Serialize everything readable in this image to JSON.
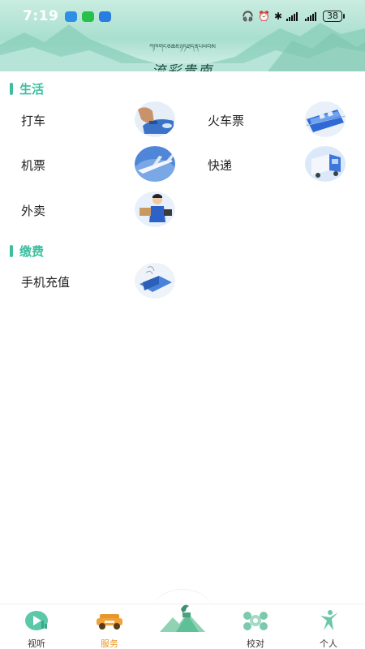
{
  "status_bar": {
    "time": "7:19",
    "battery": "38"
  },
  "brand": {
    "script_text": "ཀཁགངཅཆཇཉཏཐདནཔཕབམ",
    "title": "流彩贵南"
  },
  "sections": [
    {
      "title": "生活",
      "items": [
        {
          "label": "打车",
          "icon": "taxi-hand-icon"
        },
        {
          "label": "火车票",
          "icon": "train-icon"
        },
        {
          "label": "机票",
          "icon": "airplane-icon"
        },
        {
          "label": "快递",
          "icon": "delivery-truck-icon"
        },
        {
          "label": "外卖",
          "icon": "courier-icon"
        }
      ]
    },
    {
      "title": "缴费",
      "items": [
        {
          "label": "手机充值",
          "icon": "phone-recharge-icon"
        }
      ]
    }
  ],
  "tabbar": {
    "tabs": [
      {
        "label": "视听",
        "icon": "video-play-icon",
        "active": false
      },
      {
        "label": "服务",
        "icon": "car-icon",
        "active": true
      },
      {
        "label": "",
        "icon": "mountain-goat-icon",
        "active": false
      },
      {
        "label": "校对",
        "icon": "ornament-icon",
        "active": false
      },
      {
        "label": "个人",
        "icon": "dancer-icon",
        "active": false
      }
    ]
  },
  "colors": {
    "accent": "#3cbfa0",
    "active_tab": "#e8962b",
    "header_bg": "#a8dfcf"
  }
}
